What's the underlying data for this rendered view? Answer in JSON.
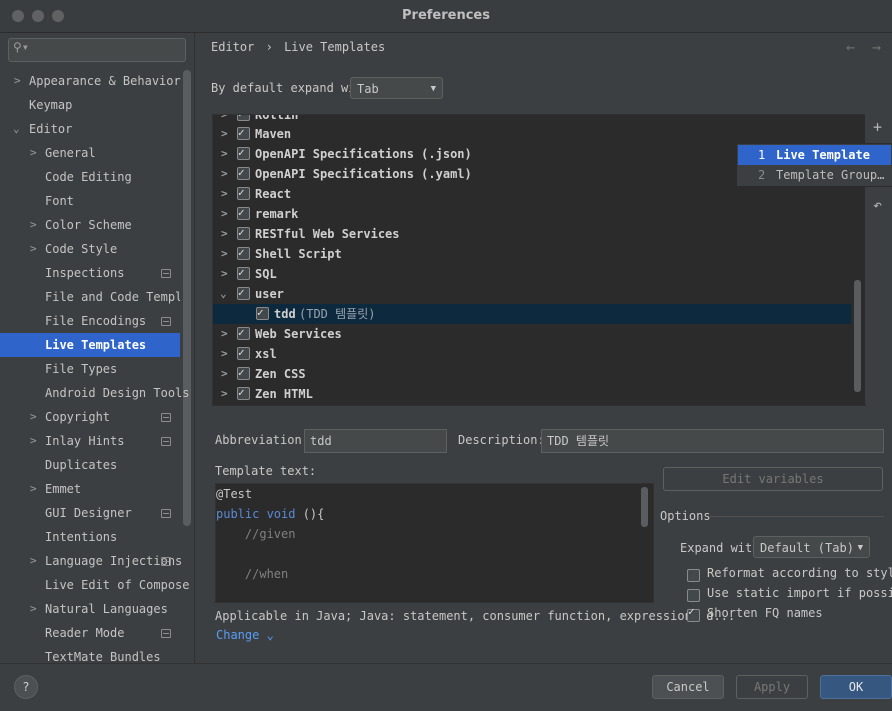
{
  "window": {
    "title": "Preferences"
  },
  "search": {
    "placeholder": ""
  },
  "sidebar": {
    "items": [
      {
        "label": "Appearance & Behavior"
      },
      {
        "label": "Keymap"
      },
      {
        "label": "Editor"
      },
      {
        "label": "General"
      },
      {
        "label": "Code Editing"
      },
      {
        "label": "Font"
      },
      {
        "label": "Color Scheme"
      },
      {
        "label": "Code Style"
      },
      {
        "label": "Inspections"
      },
      {
        "label": "File and Code Templat"
      },
      {
        "label": "File Encodings"
      },
      {
        "label": "Live Templates"
      },
      {
        "label": "File Types"
      },
      {
        "label": "Android Design Tools"
      },
      {
        "label": "Copyright"
      },
      {
        "label": "Inlay Hints"
      },
      {
        "label": "Duplicates"
      },
      {
        "label": "Emmet"
      },
      {
        "label": "GUI Designer"
      },
      {
        "label": "Intentions"
      },
      {
        "label": "Language Injections"
      },
      {
        "label": "Live Edit of Compose"
      },
      {
        "label": "Natural Languages"
      },
      {
        "label": "Reader Mode"
      },
      {
        "label": "TextMate Bundles"
      }
    ]
  },
  "breadcrumb": {
    "parent": "Editor",
    "separator": "›",
    "current": "Live Templates"
  },
  "expand": {
    "label": "By default expand with",
    "value": "Tab"
  },
  "templates": {
    "rows": [
      {
        "label": "Kotlin"
      },
      {
        "label": "Maven"
      },
      {
        "label": "OpenAPI Specifications (.json)"
      },
      {
        "label": "OpenAPI Specifications (.yaml)"
      },
      {
        "label": "React"
      },
      {
        "label": "remark"
      },
      {
        "label": "RESTful Web Services"
      },
      {
        "label": "Shell Script"
      },
      {
        "label": "SQL"
      },
      {
        "label": "user"
      },
      {
        "label": "tdd",
        "desc": "(TDD 템플릿)"
      },
      {
        "label": "Web Services"
      },
      {
        "label": "xsl"
      },
      {
        "label": "Zen CSS"
      },
      {
        "label": "Zen HTML"
      }
    ]
  },
  "popup": {
    "items": [
      {
        "num": "1",
        "label": "Live Template"
      },
      {
        "num": "2",
        "label": "Template Group…"
      }
    ]
  },
  "details": {
    "abbreviation_label": "Abbreviation:",
    "abbreviation_value": "tdd",
    "description_label": "Description:",
    "description_value": "TDD 템플릿",
    "template_text_label": "Template text:",
    "edit_variables": "Edit variables",
    "code": {
      "line1": "@Test",
      "line2_kw": "public void",
      "line2_rest": " (){",
      "line3": "    //given",
      "line4": "    //when"
    },
    "applicable": "Applicable in Java; Java: statement, consumer function, expression, d...",
    "change": "Change"
  },
  "options": {
    "title": "Options",
    "expand_label": "Expand with",
    "expand_value": "Default (Tab)",
    "reformat": "Reformat according to style",
    "static_import": "Use static import if possible",
    "shorten": "Shorten FQ names"
  },
  "footer": {
    "help": "?",
    "cancel": "Cancel",
    "apply": "Apply",
    "ok": "OK"
  }
}
